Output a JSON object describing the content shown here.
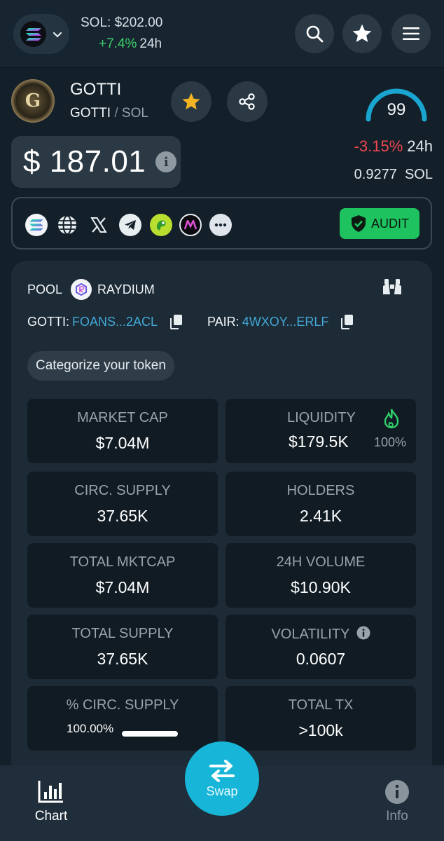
{
  "topbar": {
    "sol_price": "SOL: $202.00",
    "sol_change": "+7.4%",
    "sol_change_period": "24h"
  },
  "token": {
    "logo_letter": "G",
    "name": "GOTTI",
    "symbol": "GOTTI",
    "separator": "/",
    "quote": "SOL",
    "score": "99",
    "price": "$ 187.01",
    "change_24h": "-3.15%",
    "change_period": "24h",
    "price_in_sol": "0.9277",
    "price_in_sol_unit": "SOL"
  },
  "social": {
    "icons": [
      "solana-icon",
      "globe-icon",
      "x-icon",
      "telegram-icon",
      "parrot-icon",
      "app-icon",
      "more-icon"
    ],
    "audit_label": "AUDIT"
  },
  "pool": {
    "label": "POOL",
    "dex": "RAYDIUM",
    "token_label": "GOTTI:",
    "token_address": "FOANS...2ACL",
    "pair_label": "PAIR:",
    "pair_address": "4WXOY...ERLF",
    "categorize": "Categorize your token"
  },
  "stats": {
    "market_cap": {
      "title": "MARKET CAP",
      "value": "$7.04M"
    },
    "liquidity": {
      "title": "LIQUIDITY",
      "value": "$179.5K",
      "pct": "100%"
    },
    "circ_supply": {
      "title": "CIRC. SUPPLY",
      "value": "37.65K"
    },
    "holders": {
      "title": "HOLDERS",
      "value": "2.41K"
    },
    "total_mktcap": {
      "title": "TOTAL MKTCAP",
      "value": "$7.04M"
    },
    "volume_24h": {
      "title": "24H VOLUME",
      "value": "$10.90K"
    },
    "total_supply": {
      "title": "TOTAL SUPPLY",
      "value": "37.65K"
    },
    "volatility": {
      "title": "VOLATILITY",
      "value": "0.0607"
    },
    "pct_circ_supply": {
      "title": "% CIRC. SUPPLY",
      "value": "100.00%",
      "fill": 1.0
    },
    "total_tx": {
      "title": "TOTAL TX",
      "value": ">100k"
    }
  },
  "nav": {
    "chart": "Chart",
    "swap": "Swap",
    "info": "Info"
  },
  "colors": {
    "background": "#13202a",
    "positive": "#3ecf6a",
    "negative": "#f0474f",
    "accent": "#17b6d8",
    "audit": "#1ec25e",
    "link": "#43a7d6"
  }
}
